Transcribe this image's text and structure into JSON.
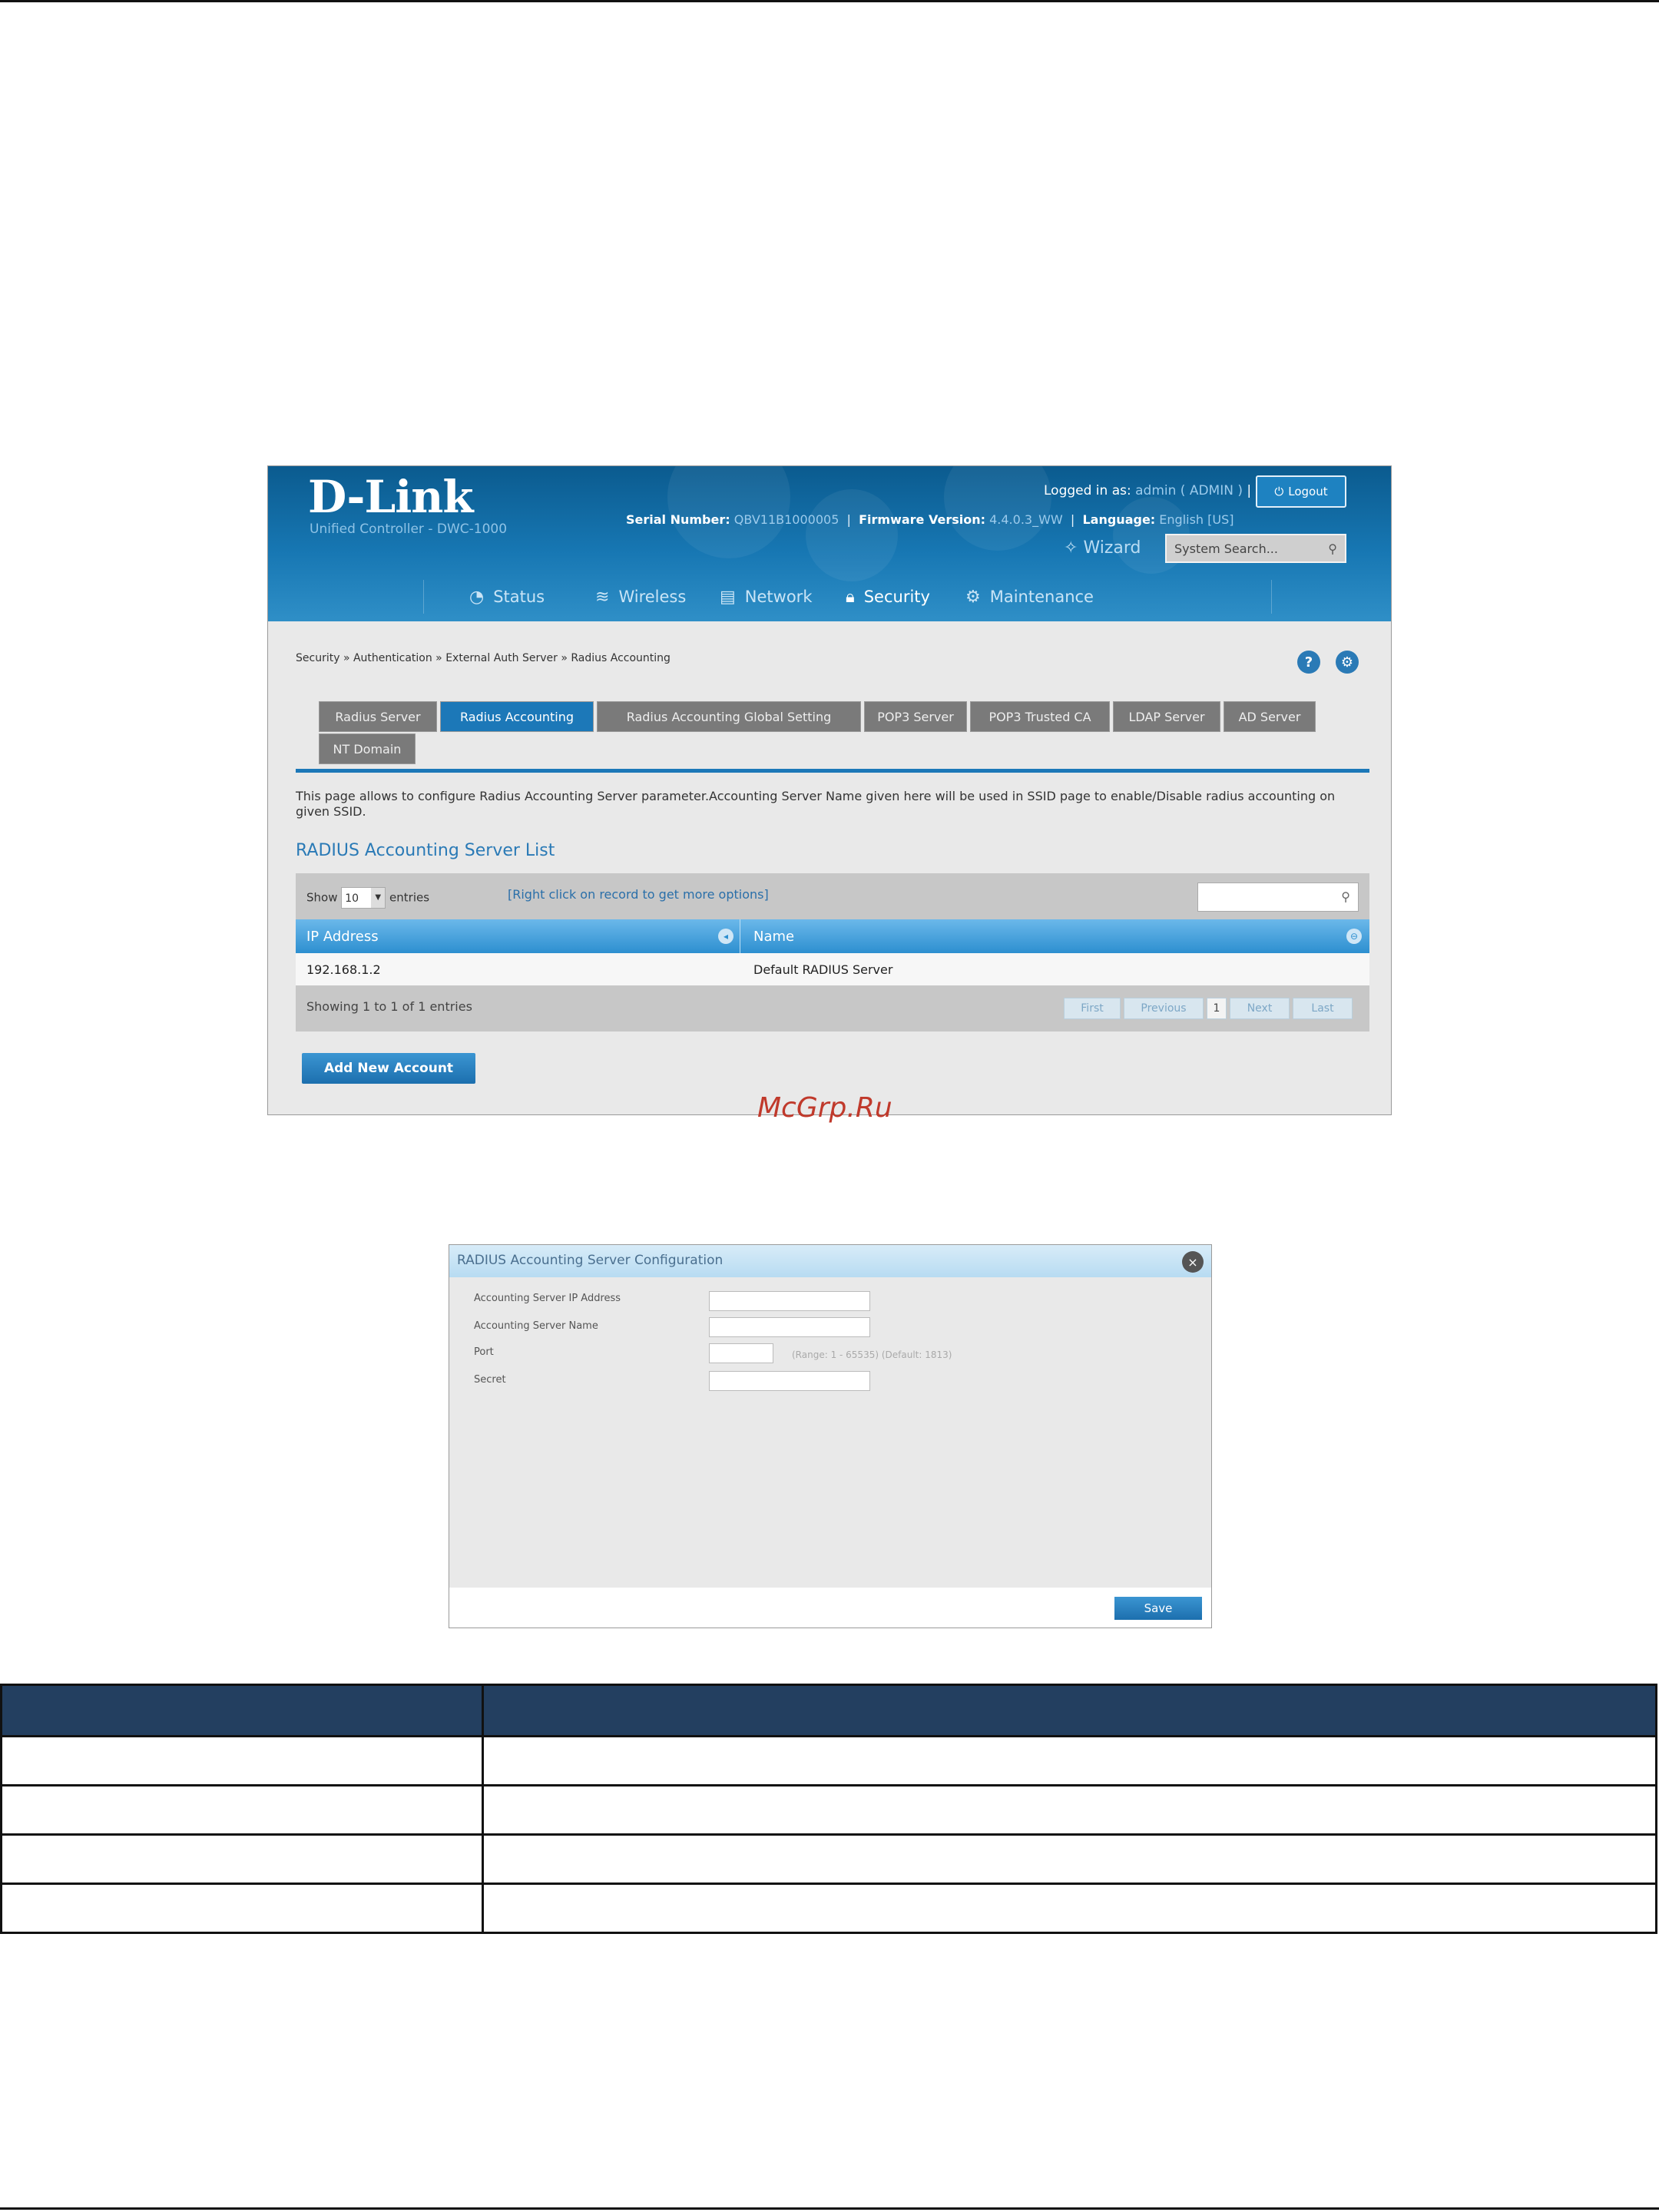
{
  "screenshot1": {
    "logo": "D-Link",
    "product": "Unified Controller - DWC-1000",
    "serial_label": "Serial Number:",
    "serial_value": "QBV11B1000005",
    "firmware_label": "Firmware Version:",
    "firmware_value": "4.4.0.3_WW",
    "language_label": "Language:",
    "language_value": "English [US]",
    "logged_in_label": "Logged in as:",
    "logged_in_value": "admin ( ADMIN )",
    "logout_label": "Logout",
    "wizard_label": "Wizard",
    "search_label": "System Search...",
    "nav": [
      {
        "label": "Status",
        "icon": "gauge-icon"
      },
      {
        "label": "Wireless",
        "icon": "wifi-icon"
      },
      {
        "label": "Network",
        "icon": "network-icon"
      },
      {
        "label": "Security",
        "icon": "lock-icon"
      },
      {
        "label": "Maintenance",
        "icon": "gears-icon"
      }
    ],
    "breadcrumb": "Security  »  Authentication  »  External Auth Server  »  Radius Accounting",
    "tabs": [
      "Radius Server",
      "Radius Accounting",
      "Radius Accounting Global Setting",
      "POP3 Server",
      "POP3 Trusted CA",
      "LDAP Server",
      "AD Server",
      "NT Domain"
    ],
    "description": "This page allows to configure Radius Accounting Server parameter.Accounting Server Name given here will be used in SSID page to enable/Disable radius accounting on given SSID.",
    "list_title": "RADIUS Accounting Server List",
    "show_label": "Show",
    "show_value": "10",
    "entries_label": "entries",
    "hint": "[Right click on record to get more options]",
    "columns": [
      "IP Address",
      "Name"
    ],
    "rows": [
      {
        "ip": "192.168.1.2",
        "name": "Default RADIUS Server"
      }
    ],
    "showing": "Showing 1 to 1 of 1 entries",
    "pagination": [
      "First",
      "Previous",
      "1",
      "Next",
      "Last"
    ],
    "add_button": "Add New Account"
  },
  "watermark": "McGrp.Ru",
  "screenshot2": {
    "title": "RADIUS Accounting Server Configuration",
    "fields": [
      {
        "label": "Accounting Server IP Address"
      },
      {
        "label": "Accounting Server Name"
      },
      {
        "label": "Port"
      },
      {
        "label": "Secret"
      }
    ],
    "port_range": "(Range: 1 - 65535) (Default: 1813)",
    "save_label": "Save"
  }
}
